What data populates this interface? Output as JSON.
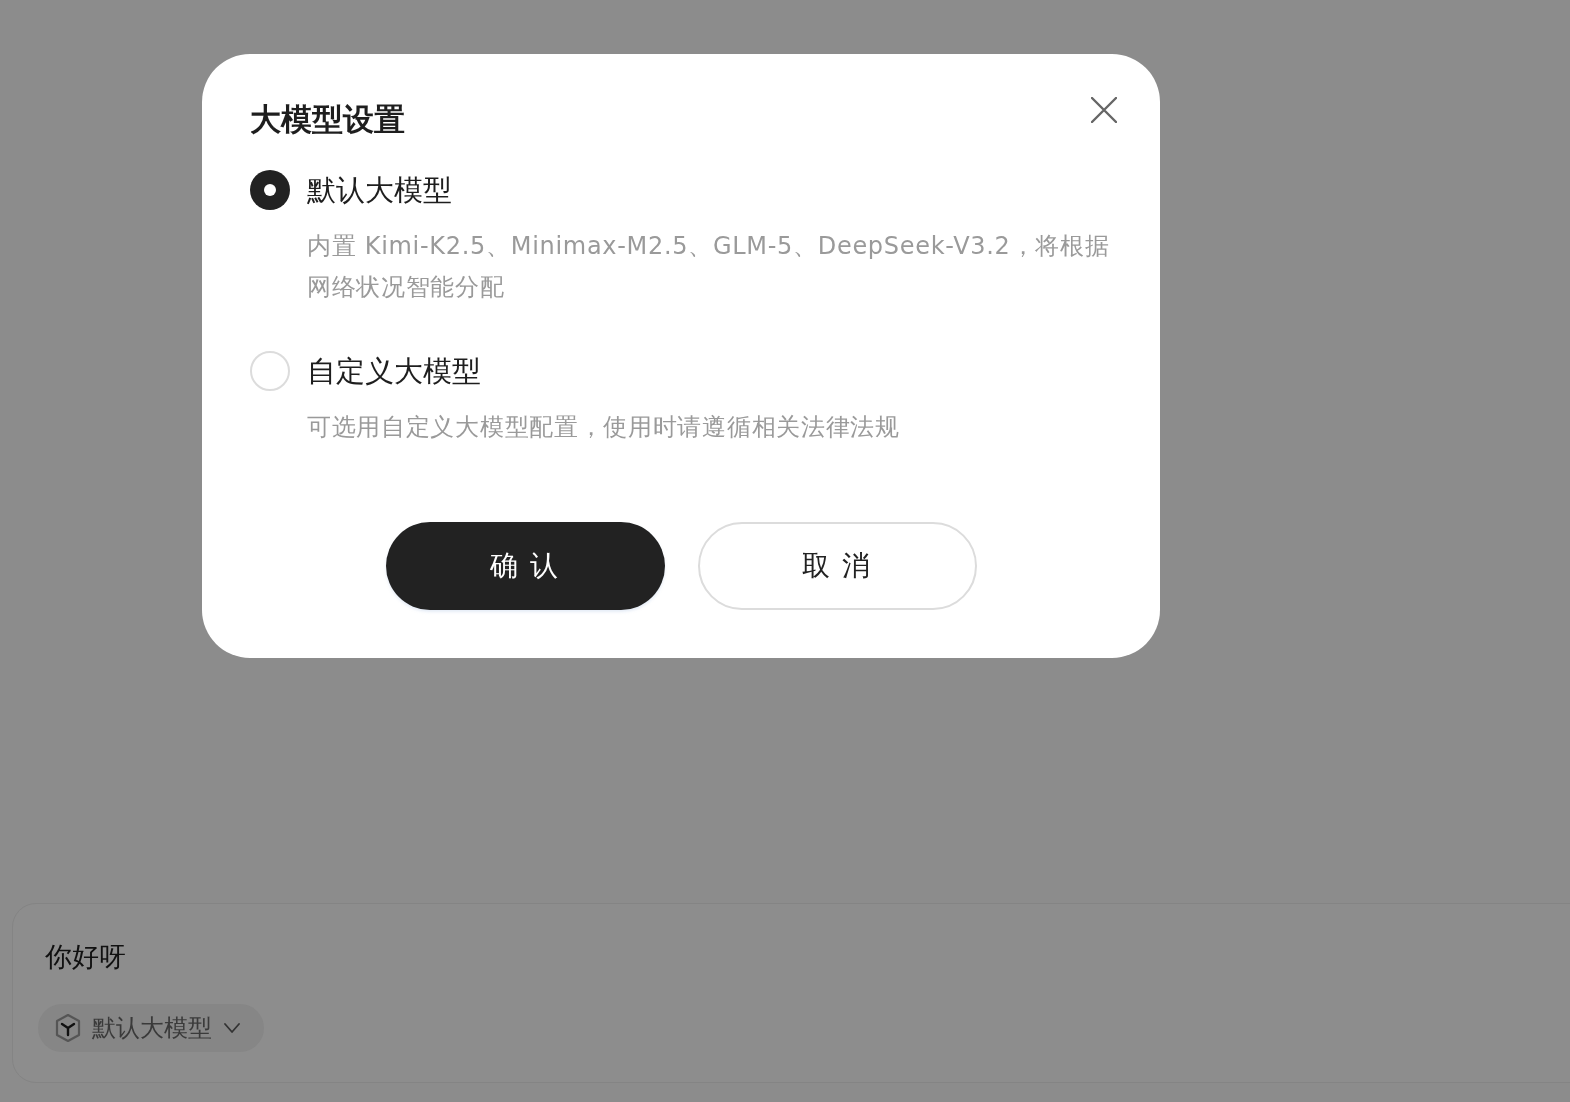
{
  "dialog": {
    "title": "大模型设置",
    "options": [
      {
        "label": "默认大模型",
        "description": "内置 Kimi-K2.5、Minimax-M2.5、GLM-5、DeepSeek-V3.2，将根据网络状况智能分配",
        "selected": true
      },
      {
        "label": "自定义大模型",
        "description": "可选用自定义大模型配置，使用时请遵循相关法律法规",
        "selected": false
      }
    ],
    "buttons": [
      {
        "label": "确 认",
        "kind": "primary"
      },
      {
        "label": "取 消",
        "kind": "secondary"
      }
    ]
  },
  "composer": {
    "value": "你好呀",
    "model_chip": {
      "label": "默认大模型"
    }
  }
}
